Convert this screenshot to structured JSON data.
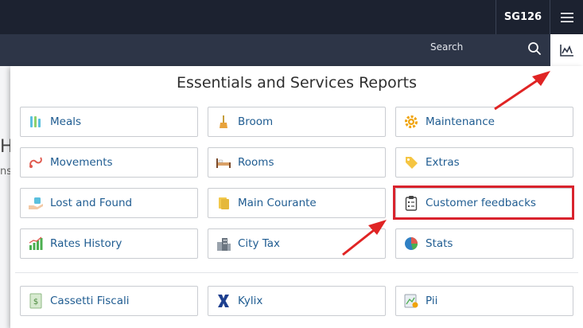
{
  "header": {
    "hotel_code": "SG126",
    "menu_icon": "hamburger-icon"
  },
  "subheader": {
    "search_label": "Search",
    "search_icon": "search-icon",
    "reports_icon": "chart-icon"
  },
  "background": {
    "heading_fragment": "H",
    "sub_fragment": "ns"
  },
  "panel": {
    "title": "Essentials and Services Reports",
    "tiles": [
      {
        "label": "Meals",
        "icon": "meals-icon"
      },
      {
        "label": "Broom",
        "icon": "broom-icon"
      },
      {
        "label": "Maintenance",
        "icon": "gear-icon"
      },
      {
        "label": "Movements",
        "icon": "movements-icon"
      },
      {
        "label": "Rooms",
        "icon": "bed-icon"
      },
      {
        "label": "Extras",
        "icon": "tag-icon"
      },
      {
        "label": "Lost and Found",
        "icon": "hand-icon"
      },
      {
        "label": "Main Courante",
        "icon": "notes-icon"
      },
      {
        "label": "Customer feedbacks",
        "icon": "clipboard-icon"
      },
      {
        "label": "Rates History",
        "icon": "bar-chart-icon"
      },
      {
        "label": "City Tax",
        "icon": "buildings-icon"
      },
      {
        "label": "Stats",
        "icon": "pie-chart-icon"
      },
      {
        "label": "Cassetti Fiscali",
        "icon": "fiscal-drawer-icon"
      },
      {
        "label": "Kylix",
        "icon": "kylix-icon"
      },
      {
        "label": "Pii",
        "icon": "pii-icon"
      }
    ]
  },
  "annotations": {
    "highlight_color": "#d9232d"
  }
}
